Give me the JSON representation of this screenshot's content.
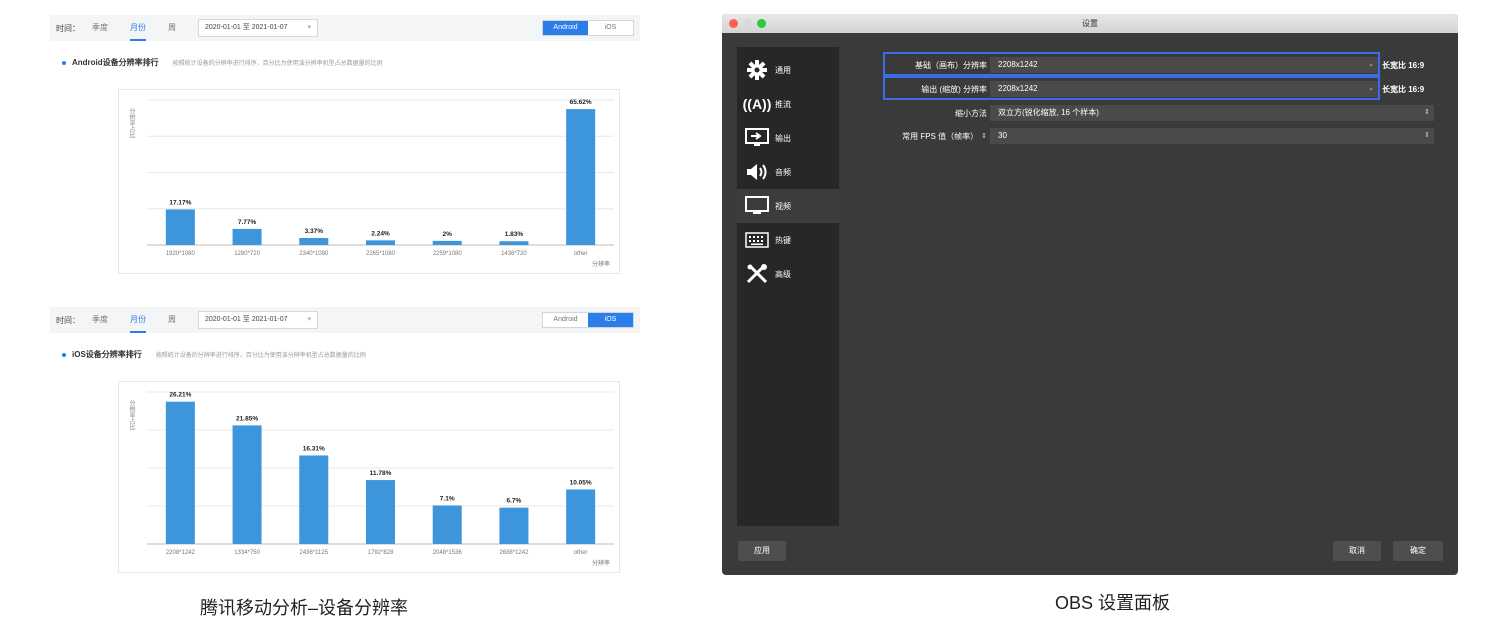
{
  "android_panel": {
    "time_label": "时间：",
    "tabs": [
      "季度",
      "月份",
      "周"
    ],
    "active_tab": "月份",
    "date_range": "2020-01-01 至 2021-01-07",
    "platforms": [
      "Android",
      "iOS"
    ],
    "active_platform": "Android",
    "heading": "Android设备分辨率排行",
    "description": "按照统计设备的分辨率进行排序，百分比为使用该分辨率机型占总数据量的比例"
  },
  "ios_panel": {
    "time_label": "时间：",
    "tabs": [
      "季度",
      "月份",
      "周"
    ],
    "active_tab": "月份",
    "date_range": "2020-01-01 至 2021-01-07",
    "platforms": [
      "Android",
      "iOS"
    ],
    "active_platform": "iOS",
    "heading": "iOS设备分辨率排行",
    "description": "按照统计设备的分辨率进行排序，百分比为使用该分辨率机型占总数据量的比例"
  },
  "chart_data": [
    {
      "type": "bar",
      "title": "",
      "ylabel": "分辨率占比",
      "xlabel": "分辨率",
      "categories": [
        "1920*1080",
        "1280*720",
        "2340*1080",
        "2265*1080",
        "2259*1080",
        "1436*720",
        "other"
      ],
      "values": [
        17.17,
        7.77,
        3.37,
        2.24,
        2,
        1.83,
        65.62
      ],
      "value_labels": [
        "17.17%",
        "7.77%",
        "3.37%",
        "2.24%",
        "2%",
        "1.83%",
        "65.62%"
      ],
      "ylim": [
        0,
        70
      ],
      "color": "#3d96dc"
    },
    {
      "type": "bar",
      "title": "",
      "ylabel": "分辨率占比",
      "xlabel": "分辨率",
      "categories": [
        "2208*1242",
        "1334*750",
        "2436*1125",
        "1792*828",
        "2048*1536",
        "2688*1242",
        "other"
      ],
      "values": [
        26.21,
        21.85,
        16.31,
        11.78,
        7.1,
        6.7,
        10.05
      ],
      "value_labels": [
        "26.21%",
        "21.85%",
        "16.31%",
        "11.78%",
        "7.1%",
        "6.7%",
        "10.05%"
      ],
      "ylim": [
        0,
        28
      ],
      "color": "#3d96dc"
    }
  ],
  "captions": {
    "left": "腾讯移动分析–设备分辨率",
    "right": "OBS 设置面板"
  },
  "obs": {
    "window_title": "设置",
    "sidebar": [
      {
        "label": "通用",
        "icon": "gear-icon"
      },
      {
        "label": "推流",
        "icon": "antenna-icon"
      },
      {
        "label": "输出",
        "icon": "output-icon"
      },
      {
        "label": "音频",
        "icon": "speaker-icon"
      },
      {
        "label": "视频",
        "icon": "monitor-icon"
      },
      {
        "label": "热键",
        "icon": "keyboard-icon"
      },
      {
        "label": "高级",
        "icon": "tools-icon"
      }
    ],
    "selected": "视频",
    "base_res_label": "基础（画布）分辨率",
    "base_res_value": "2208x1242",
    "base_aspect": "长宽比 16:9",
    "output_res_label": "输出 (缩放) 分辨率",
    "output_res_value": "2208x1242",
    "output_aspect": "长宽比 16:9",
    "downscale_label": "缩小方法",
    "downscale_value": "双立方(锐化缩放, 16 个样本)",
    "fps_label": "常用 FPS 值（帧率）",
    "fps_value": "30",
    "apply_btn": "应用",
    "cancel_btn": "取消",
    "ok_btn": "确定",
    "highlight_color": "#3b6de6"
  }
}
